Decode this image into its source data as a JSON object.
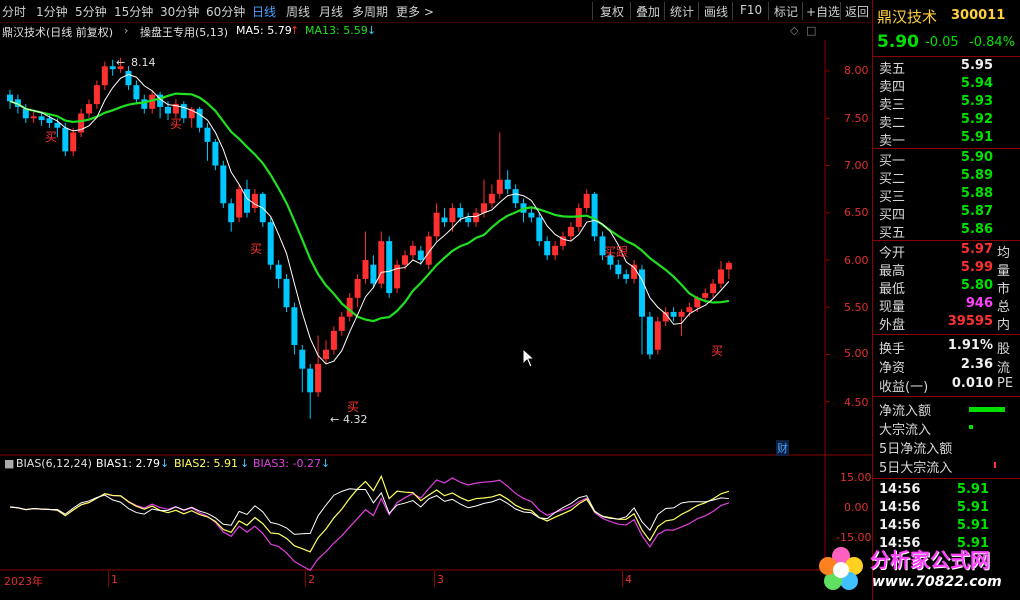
{
  "toolbar": {
    "periods": [
      "分时",
      "1分钟",
      "5分钟",
      "15分钟",
      "30分钟",
      "60分钟",
      "日线",
      "周线",
      "月线",
      "多周期",
      "更多 >"
    ],
    "actions": [
      "复权",
      "叠加",
      "统计",
      "画线",
      "F10",
      "标记",
      "+自选",
      "返回"
    ]
  },
  "info": {
    "stock": "鼎汉技术(日线 前复权)",
    "indicator": "操盘王专用(5,13)",
    "ma5": "MA5: 5.79",
    "ma13": "MA13: 5.59"
  },
  "price_axis": [
    "8.00",
    "7.50",
    "7.00",
    "6.50",
    "6.00",
    "5.50",
    "5.00",
    "4.50"
  ],
  "bias_axis": [
    "15.00",
    "0.00",
    "-15.00"
  ],
  "annotations": {
    "high": "8.14",
    "low": "4.32",
    "buy": "买",
    "follow": "跟",
    "cai": "财"
  },
  "bias": {
    "label": "BIAS(6,12,24)",
    "b1": "BIAS1: 2.79",
    "b2": "BIAS2: 5.91",
    "b3": "BIAS3: -0.27"
  },
  "date_axis": [
    "2023年",
    "1",
    "2",
    "3",
    "4"
  ],
  "panel": {
    "name": "鼎汉技术",
    "code": "300011",
    "price": "5.90",
    "change": "-0.05",
    "pct": "-0.84%",
    "asks": [
      {
        "label": "卖五",
        "price": "5.95"
      },
      {
        "label": "卖四",
        "price": "5.94"
      },
      {
        "label": "卖三",
        "price": "5.93"
      },
      {
        "label": "卖二",
        "price": "5.92"
      },
      {
        "label": "卖一",
        "price": "5.91"
      }
    ],
    "bids": [
      {
        "label": "买一",
        "price": "5.90"
      },
      {
        "label": "买二",
        "price": "5.89"
      },
      {
        "label": "买三",
        "price": "5.88"
      },
      {
        "label": "买四",
        "price": "5.87"
      },
      {
        "label": "买五",
        "price": "5.86"
      }
    ],
    "stats": [
      {
        "label": "今开",
        "value": "5.97",
        "tail": "均"
      },
      {
        "label": "最高",
        "value": "5.99",
        "tail": "量"
      },
      {
        "label": "最低",
        "value": "5.80",
        "tail": "市"
      },
      {
        "label": "现量",
        "value": "946",
        "tail": "总"
      },
      {
        "label": "外盘",
        "value": "39595",
        "tail": "内"
      }
    ],
    "stats2": [
      {
        "label": "换手",
        "value": "1.91%",
        "tail": "股"
      },
      {
        "label": "净资",
        "value": "2.36",
        "tail": "流"
      },
      {
        "label": "收益(一)",
        "value": "0.010",
        "tail": "PE"
      }
    ],
    "flows": [
      "净流入额",
      "大宗流入",
      "5日净流入额",
      "5日大宗流入"
    ],
    "ticks": [
      {
        "time": "14:56",
        "price": "5.91"
      },
      {
        "time": "14:56",
        "price": "5.91"
      },
      {
        "time": "14:56",
        "price": "5.91"
      },
      {
        "time": "14:56",
        "price": "5.91"
      }
    ]
  },
  "watermark": {
    "text": "分析家公式网",
    "url": "www.70822.com"
  },
  "colors": {
    "up": "#ff3030",
    "down": "#00c8ff",
    "ma13": "#20e020",
    "ma5": "#ffffff",
    "bias1": "#ffffff",
    "bias2": "#ffff60",
    "bias3": "#e040e0"
  }
}
